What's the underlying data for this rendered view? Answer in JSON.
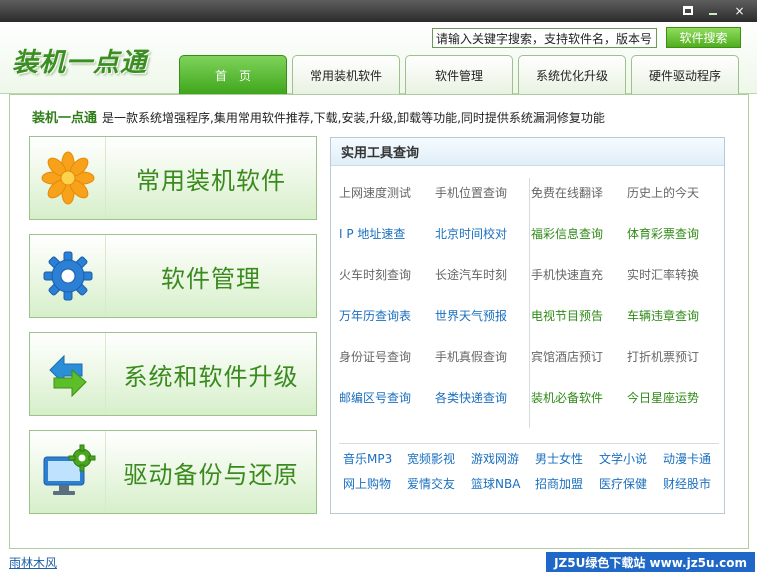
{
  "window": {
    "close": "×"
  },
  "app": {
    "logo": "装机一点通"
  },
  "search": {
    "value": "请输入关键字搜索，支持软件名，版本号",
    "button": "软件搜索"
  },
  "tabs": [
    {
      "label": "首　页"
    },
    {
      "label": "常用装机软件"
    },
    {
      "label": "软件管理"
    },
    {
      "label": "系统优化升级"
    },
    {
      "label": "硬件驱动程序"
    }
  ],
  "intro": {
    "name": "装机一点通",
    "text": "是一款系统增强程序,集用常用软件推荐,下载,安装,升级,卸载等功能,同时提供系统漏洞修复功能"
  },
  "buttons": [
    {
      "label": "常用装机软件"
    },
    {
      "label": "软件管理"
    },
    {
      "label": "系统和软件升级"
    },
    {
      "label": "驱动备份与还原"
    }
  ],
  "tools": {
    "title": "实用工具查询",
    "items": [
      "上网速度测试",
      "手机位置查询",
      "免费在线翻译",
      "历史上的今天",
      "I P 地址速查",
      "北京时间校对",
      "福彩信息查询",
      "体育彩票查询",
      "火车时刻查询",
      "长途汽车时刻",
      "手机快速直充",
      "实时汇率转换",
      "万年历查询表",
      "世界天气预报",
      "电视节目预告",
      "车辆违章查询",
      "身份证号查询",
      "手机真假查询",
      "宾馆酒店预订",
      "打折机票预订",
      "邮编区号查询",
      "各类快递查询",
      "装机必备软件",
      "今日星座运势"
    ],
    "categories": [
      "音乐MP3",
      "宽频影视",
      "游戏网游",
      "男士女性",
      "文学小说",
      "动漫卡通",
      "网上购物",
      "爱情交友",
      "篮球NBA",
      "招商加盟",
      "医疗保健",
      "财经股市"
    ]
  },
  "colors": {
    "gray": "#666666",
    "blue": "#1a6fbf",
    "green": "#2f8a17"
  },
  "footer": {
    "left": "雨林木风",
    "watermark": "JZ5U绿色下载站 www.jz5u.com"
  }
}
